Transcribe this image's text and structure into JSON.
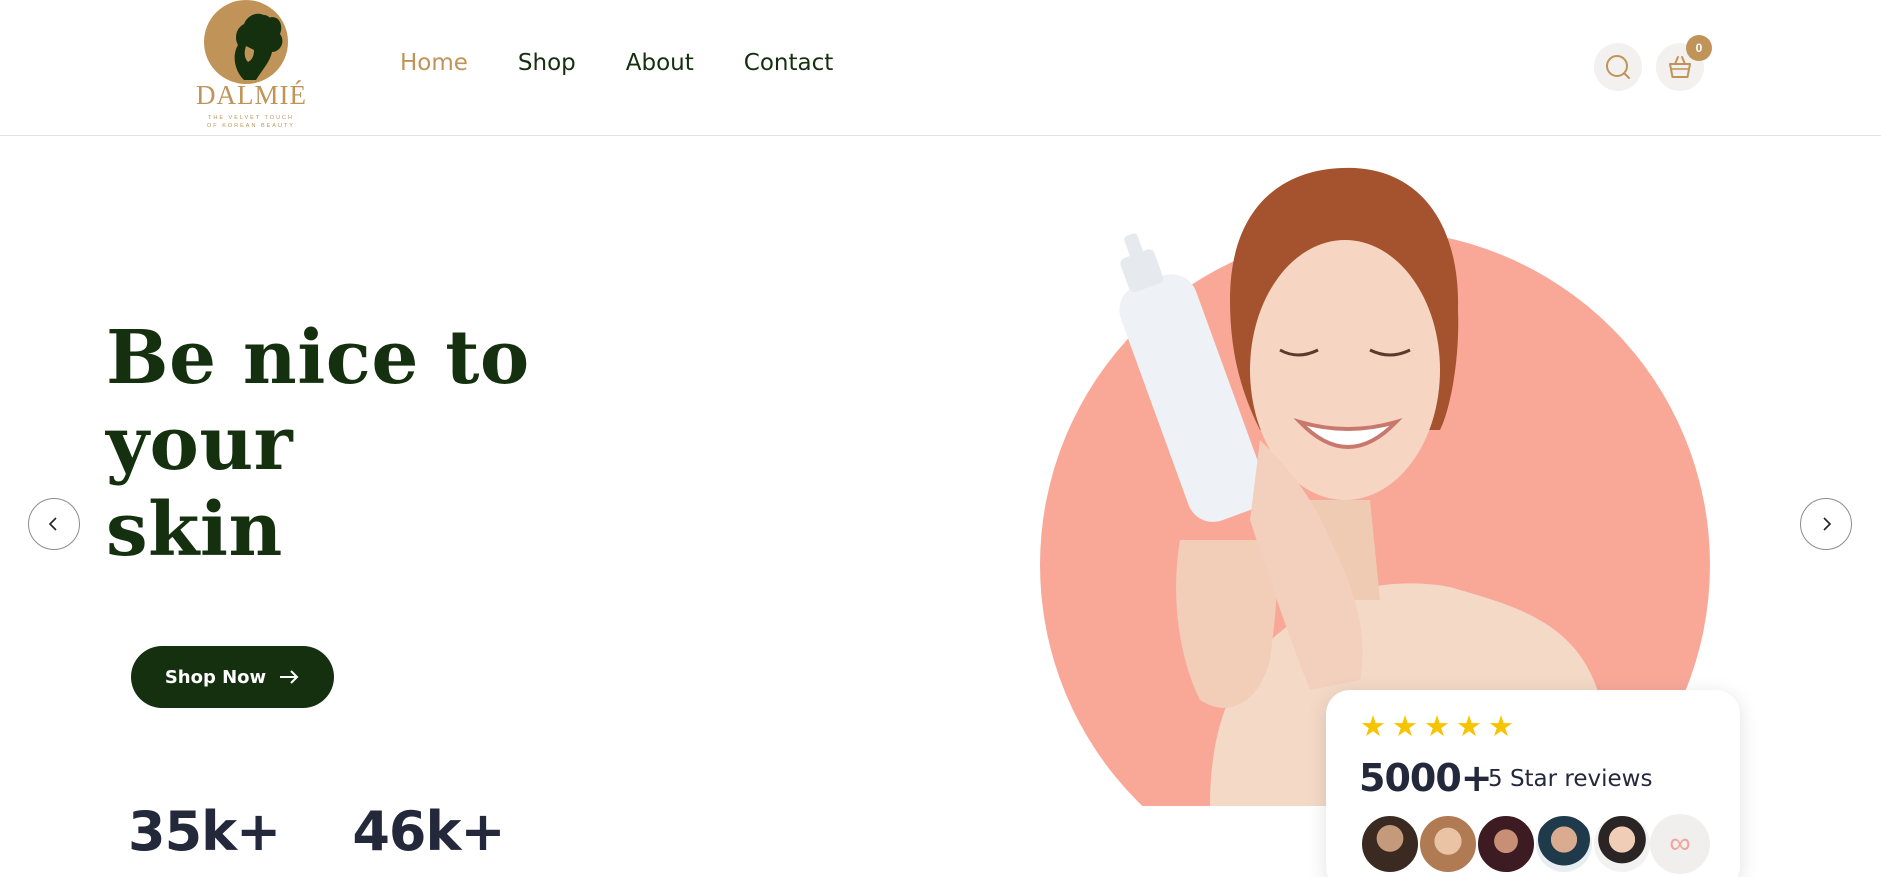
{
  "brand": {
    "name": "DALMIÉ",
    "tagline_line1": "THE VELVET TOUCH",
    "tagline_line2": "OF KOREAN BEAUTY"
  },
  "nav": {
    "items": [
      {
        "label": "Home",
        "active": true
      },
      {
        "label": "Shop",
        "active": false
      },
      {
        "label": "About",
        "active": false
      },
      {
        "label": "Contact",
        "active": false
      }
    ]
  },
  "header": {
    "search_icon": "search-icon",
    "cart_icon": "basket-icon",
    "cart_count": "0"
  },
  "hero": {
    "title_line1": "Be nice to your",
    "title_line2": "skin",
    "cta_label": "Shop Now",
    "cta_icon": "arrow-right-icon",
    "prev_icon": "chevron-left-icon",
    "next_icon": "chevron-right-icon"
  },
  "stats": [
    {
      "value": "35k+"
    },
    {
      "value": "46k+"
    }
  ],
  "reviews": {
    "rating_stars": 5,
    "count": "5000+",
    "label": "5 Star reviews",
    "more_icon": "infinity-icon"
  },
  "colors": {
    "brand_gold": "#c09358",
    "brand_green": "#14300f",
    "accent_pink": "#f9a898",
    "star_yellow": "#f7c400",
    "stat_text": "#24283b"
  }
}
